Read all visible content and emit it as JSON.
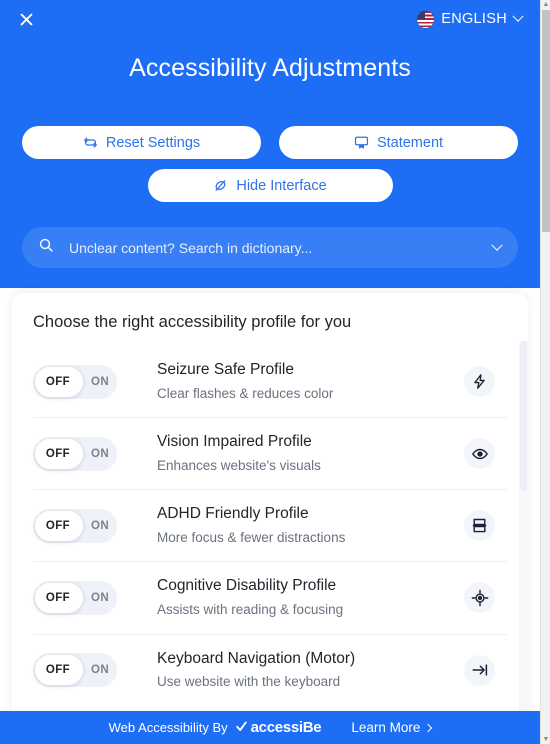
{
  "header": {
    "close_icon": "close-icon",
    "language": {
      "flag_icon": "us-flag-icon",
      "label": "ENGLISH",
      "chevron_icon": "chevron-down-icon"
    },
    "title": "Accessibility Adjustments",
    "buttons": [
      {
        "label": "Reset Settings",
        "icon": "reset-arrows-icon"
      },
      {
        "label": "Statement",
        "icon": "statement-monitor-icon"
      },
      {
        "label": "Hide Interface",
        "icon": "eye-slash-icon"
      }
    ]
  },
  "search": {
    "icon": "search-icon",
    "placeholder": "Unclear content? Search in dictionary...",
    "value": "",
    "chevron_icon": "chevron-down-icon"
  },
  "card": {
    "heading": "Choose the right accessibility profile for you",
    "toggle": {
      "off_label": "OFF",
      "on_label": "ON"
    },
    "profiles": [
      {
        "name": "Seizure Safe Profile",
        "desc": "Clear flashes & reduces color",
        "state": "OFF",
        "icon": "lightning-bolt-icon"
      },
      {
        "name": "Vision Impaired Profile",
        "desc": "Enhances website's visuals",
        "state": "OFF",
        "icon": "eye-icon"
      },
      {
        "name": "ADHD Friendly Profile",
        "desc": "More focus & fewer distractions",
        "state": "OFF",
        "icon": "focus-bars-icon"
      },
      {
        "name": "Cognitive Disability Profile",
        "desc": "Assists with reading & focusing",
        "state": "OFF",
        "icon": "crosshair-target-icon"
      },
      {
        "name": "Keyboard Navigation (Motor)",
        "desc": "Use website with the keyboard",
        "state": "OFF",
        "icon": "tab-arrow-icon"
      }
    ]
  },
  "footer": {
    "brand_prefix": "Web Accessibility By",
    "brand_name": "accessiBe",
    "brand_check_icon": "check-icon",
    "learn_more": "Learn More",
    "learn_more_chevron": "chevron-right-icon"
  },
  "colors": {
    "brand_blue": "#1d6ef5",
    "button_text": "#2f73e8",
    "card_bg": "#ffffff",
    "toggle_track": "#eef1f7",
    "profile_name": "#21252c",
    "profile_desc": "#6a7280"
  }
}
